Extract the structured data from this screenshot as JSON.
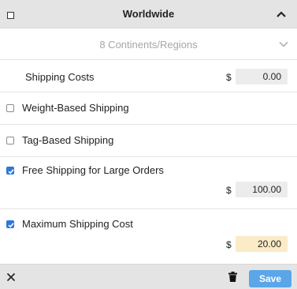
{
  "header": {
    "title": "Worldwide"
  },
  "regions": {
    "summary": "8 Continents/Regions"
  },
  "shipping_costs": {
    "label": "Shipping Costs",
    "currency": "$",
    "value": "0.00"
  },
  "weight_based": {
    "label": "Weight-Based Shipping",
    "checked": false
  },
  "tag_based": {
    "label": "Tag-Based Shipping",
    "checked": false
  },
  "free_shipping": {
    "label": "Free Shipping for Large Orders",
    "checked": true,
    "currency": "$",
    "value": "100.00"
  },
  "max_cost": {
    "label": "Maximum Shipping Cost",
    "checked": true,
    "currency": "$",
    "value": "20.00"
  },
  "footer": {
    "save_label": "Save",
    "close_icon": "close-icon",
    "delete_icon": "trash-icon"
  },
  "colors": {
    "accent": "#2f78d6",
    "save_button": "#5aa6e8",
    "highlight_field": "#fbebc6",
    "header_bg": "#e4e4e4"
  }
}
